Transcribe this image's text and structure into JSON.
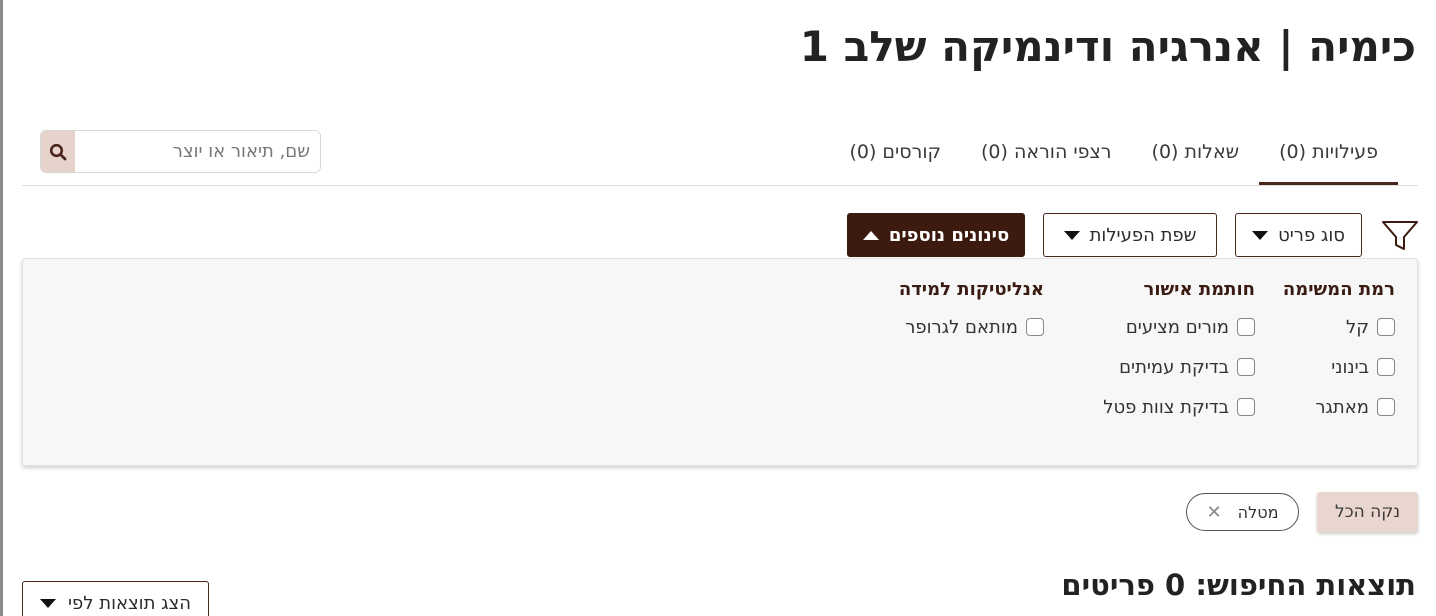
{
  "page": {
    "title": "כימיה | אנרגיה ודינמיקה שלב 1"
  },
  "tabs": [
    {
      "label": "פעילויות (0)",
      "active": true
    },
    {
      "label": "שאלות (0)",
      "active": false
    },
    {
      "label": "רצפי הוראה (0)",
      "active": false
    },
    {
      "label": "קורסים (0)",
      "active": false
    }
  ],
  "search": {
    "placeholder": "שם, תיאור או יוצר",
    "value": ""
  },
  "filters": {
    "item_type": "סוג פריט",
    "activity_language": "שפת הפעילות",
    "more_filters": "סינונים נוספים"
  },
  "panel": {
    "groups": [
      {
        "title": "רמת המשימה",
        "options": [
          "קל",
          "בינוני",
          "מאתגר"
        ]
      },
      {
        "title": "חותמת אישור",
        "options": [
          "מורים מציעים",
          "בדיקת עמיתים",
          "בדיקת צוות פטל"
        ]
      },
      {
        "title": "אנליטיקות למידה",
        "options": [
          "מותאם לגרופר"
        ]
      }
    ]
  },
  "active_chip": {
    "label": "מטלה"
  },
  "clear_all": "נקה הכל",
  "results": {
    "title": "תוצאות החיפוש: 0 פריטים"
  },
  "sort": {
    "label": "הצג תוצאות לפי"
  },
  "colors": {
    "accent": "#3c1a0f",
    "accent_light": "#e6d3cc",
    "panel_bg": "#f7f7f7"
  }
}
